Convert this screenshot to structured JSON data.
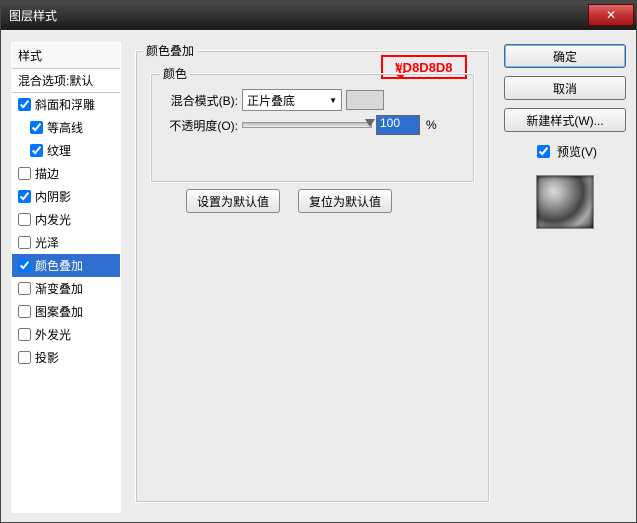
{
  "window": {
    "title": "图层样式",
    "close": "✕"
  },
  "styles": {
    "header": "样式",
    "blending": "混合选项:默认",
    "items": [
      {
        "label": "斜面和浮雕",
        "checked": true,
        "indent": false
      },
      {
        "label": "等高线",
        "checked": true,
        "indent": true
      },
      {
        "label": "纹理",
        "checked": true,
        "indent": true
      },
      {
        "label": "描边",
        "checked": false,
        "indent": false
      },
      {
        "label": "内阴影",
        "checked": true,
        "indent": false
      },
      {
        "label": "内发光",
        "checked": false,
        "indent": false
      },
      {
        "label": "光泽",
        "checked": false,
        "indent": false
      },
      {
        "label": "颜色叠加",
        "checked": true,
        "indent": false,
        "selected": true
      },
      {
        "label": "渐变叠加",
        "checked": false,
        "indent": false
      },
      {
        "label": "图案叠加",
        "checked": false,
        "indent": false
      },
      {
        "label": "外发光",
        "checked": false,
        "indent": false
      },
      {
        "label": "投影",
        "checked": false,
        "indent": false
      }
    ]
  },
  "panel": {
    "title": "颜色叠加",
    "group": "颜色",
    "blend_label": "混合模式(B):",
    "blend_value": "正片叠底",
    "color_hex": "#D8D8D8",
    "opacity_label": "不透明度(O):",
    "opacity_value": "100",
    "percent": "%",
    "set_default": "设置为默认值",
    "reset_default": "复位为默认值"
  },
  "right": {
    "ok": "确定",
    "cancel": "取消",
    "new_style": "新建样式(W)...",
    "preview_label": "预览(V)",
    "preview_checked": true
  },
  "annotation": {
    "hex": "#D8D8D8",
    "arrow": "↘"
  }
}
